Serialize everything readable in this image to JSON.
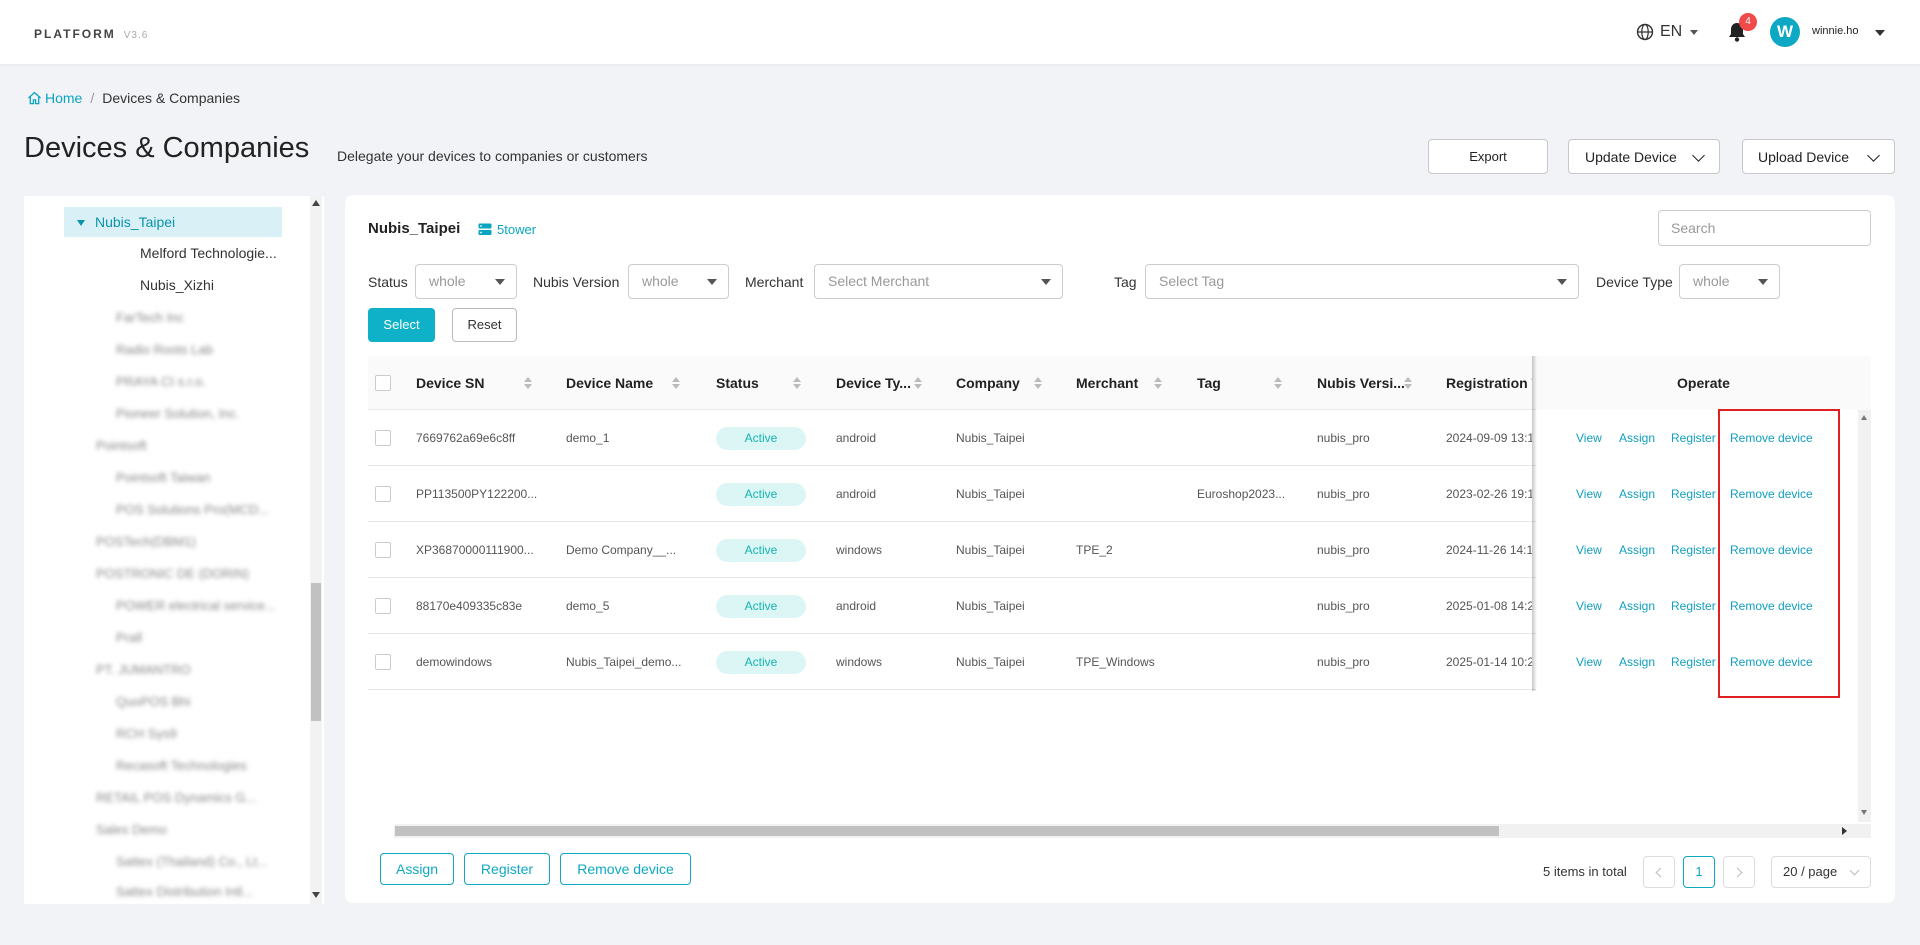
{
  "header": {
    "brand": "PLATFORM",
    "version": "V3.6",
    "language": "EN",
    "notification_count": "4",
    "avatar_letter": "W",
    "username": "winnie.ho"
  },
  "breadcrumb": {
    "home": "Home",
    "current": "Devices & Companies"
  },
  "page": {
    "title": "Devices & Companies",
    "subtitle": "Delegate your devices to companies or customers",
    "export_label": "Export",
    "update_label": "Update Device",
    "upload_label": "Upload Device"
  },
  "sidebar": {
    "selected": "Nubis_Taipei",
    "children": [
      "Melford Technologie...",
      "Nubis_Xizhi"
    ],
    "obscured_items": [
      "FarTech Inc",
      "Radio Roots Lab",
      "PRAYA CI s.r.o.",
      "Pioneer Solution, Inc.",
      "Pointsoft",
      "Pointsoft Taiwan",
      "POS Solutions Pro(MCD...",
      "POSTech(DBM1)",
      "POSTRONIC DE (DORIN)",
      "POWER electrical service...",
      "Prall",
      "PT. JUMANTRO",
      "QuoPOS Bhi",
      "RCH Sys9",
      "Recasoft Technologies",
      "RETAIL POS Dynamics G...",
      "Sales Demo",
      "Sattex (Thailand) Co., Lt...",
      "Sattex Distribution Intl..."
    ]
  },
  "panel": {
    "title": "Nubis_Taipei",
    "tower_label": "5tower",
    "search_placeholder": "Search"
  },
  "filters": {
    "status_label": "Status",
    "status_value": "whole",
    "version_label": "Nubis Version",
    "version_value": "whole",
    "merchant_label": "Merchant",
    "merchant_placeholder": "Select Merchant",
    "tag_label": "Tag",
    "tag_placeholder": "Select Tag",
    "device_type_label": "Device Type",
    "device_type_value": "whole",
    "select_button": "Select",
    "reset_button": "Reset"
  },
  "table": {
    "columns": [
      "Device SN",
      "Device Name",
      "Status",
      "Device Ty...",
      "Company",
      "Merchant",
      "Tag",
      "Nubis Versi...",
      "Registration T",
      "Operate"
    ],
    "rows": [
      {
        "sn": "7669762a69e6c8ff",
        "name": "demo_1",
        "status": "Active",
        "type": "android",
        "company": "Nubis_Taipei",
        "merchant": "",
        "tag": "",
        "version": "nubis_pro",
        "registration": "2024-09-09 13:1"
      },
      {
        "sn": "PP113500PY122200...",
        "name": "",
        "status": "Active",
        "type": "android",
        "company": "Nubis_Taipei",
        "merchant": "",
        "tag": "Euroshop2023...",
        "version": "nubis_pro",
        "registration": "2023-02-26 19:1"
      },
      {
        "sn": "XP36870000111900...",
        "name": "Demo Company__...",
        "status": "Active",
        "type": "windows",
        "company": "Nubis_Taipei",
        "merchant": "TPE_2",
        "tag": "",
        "version": "nubis_pro",
        "registration": "2024-11-26 14:1"
      },
      {
        "sn": "88170e409335c83e",
        "name": "demo_5",
        "status": "Active",
        "type": "android",
        "company": "Nubis_Taipei",
        "merchant": "",
        "tag": "",
        "version": "nubis_pro",
        "registration": "2025-01-08 14:2"
      },
      {
        "sn": "demowindows",
        "name": "Nubis_Taipei_demo...",
        "status": "Active",
        "type": "windows",
        "company": "Nubis_Taipei",
        "merchant": "TPE_Windows",
        "tag": "",
        "version": "nubis_pro",
        "registration": "2025-01-14 10:2"
      }
    ],
    "operations": [
      "View",
      "Assign",
      "Register",
      "Remove device"
    ]
  },
  "footer": {
    "assign": "Assign",
    "register": "Register",
    "remove": "Remove device",
    "total": "5 items in total",
    "current_page": "1",
    "page_size": "20 / page"
  },
  "colors": {
    "accent": "#0fa8c4",
    "highlight": "#e02020",
    "active_bg": "#dbf6f5",
    "active_text": "#14b3ad"
  }
}
